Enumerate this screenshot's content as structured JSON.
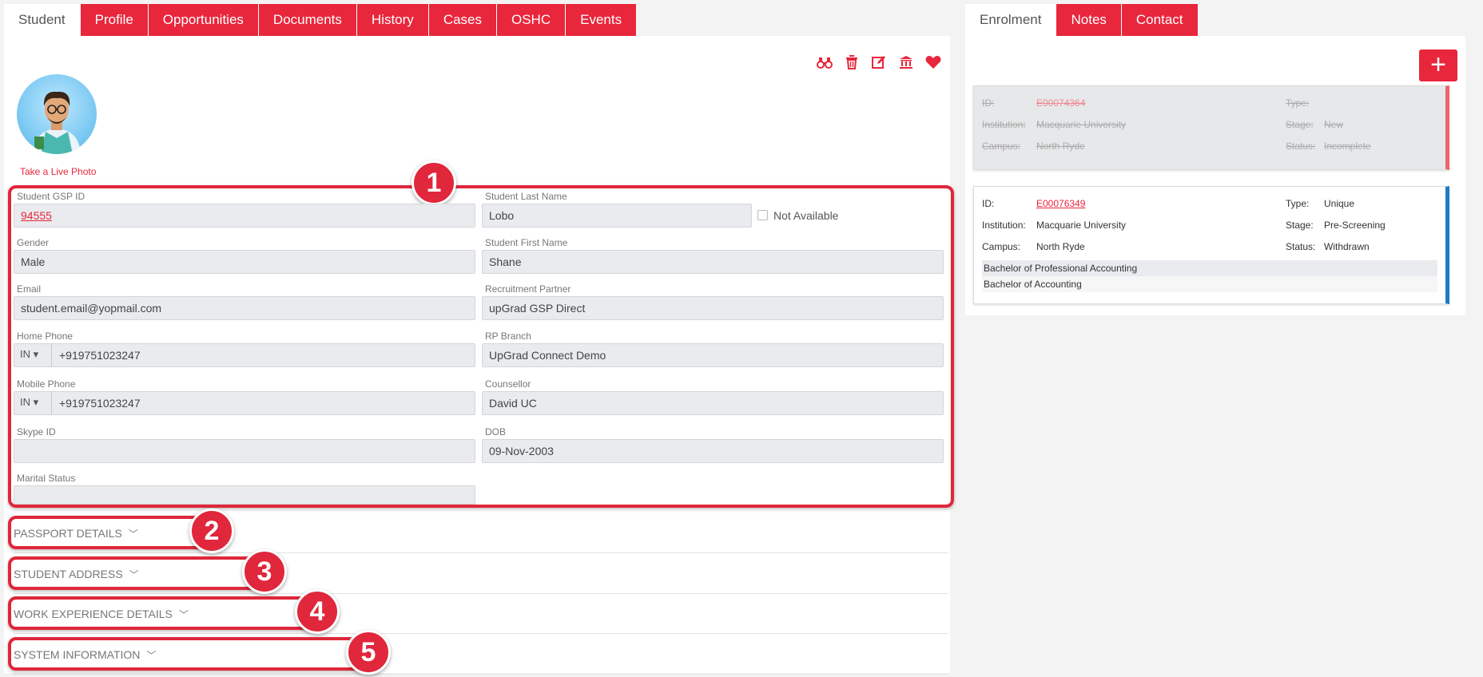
{
  "left_tabs": [
    "Student",
    "Profile",
    "Opportunities",
    "Documents",
    "History",
    "Cases",
    "OSHC",
    "Events"
  ],
  "right_tabs": [
    "Enrolment",
    "Notes",
    "Contact"
  ],
  "toolbar_icons": [
    "binoculars-icon",
    "trash-icon",
    "edit-icon",
    "institution-icon",
    "heart-icon"
  ],
  "live_photo_label": "Take a Live Photo",
  "fields": {
    "gsp_id": {
      "label": "Student GSP ID",
      "value": "94555"
    },
    "last_name": {
      "label": "Student Last Name",
      "value": "Lobo"
    },
    "not_available": "Not Available",
    "gender": {
      "label": "Gender",
      "value": "Male"
    },
    "first_name": {
      "label": "Student First Name",
      "value": "Shane"
    },
    "email": {
      "label": "Email",
      "value": "student.email@yopmail.com"
    },
    "partner": {
      "label": "Recruitment Partner",
      "value": "upGrad GSP Direct"
    },
    "home_phone": {
      "label": "Home Phone",
      "cc": "IN",
      "value": "+919751023247"
    },
    "rp_branch": {
      "label": "RP Branch",
      "value": "UpGrad Connect Demo"
    },
    "mobile_phone": {
      "label": "Mobile Phone",
      "cc": "IN",
      "value": "+919751023247"
    },
    "counsellor": {
      "label": "Counsellor",
      "value": "David UC"
    },
    "skype": {
      "label": "Skype ID",
      "value": ""
    },
    "dob": {
      "label": "DOB",
      "value": "09-Nov-2003"
    },
    "marital": {
      "label": "Marital Status",
      "value": ""
    }
  },
  "sections": [
    "PASSPORT DETAILS",
    "STUDENT ADDRESS",
    "WORK EXPERIENCE DETAILS",
    "SYSTEM INFORMATION"
  ],
  "badges": [
    "1",
    "2",
    "3",
    "4",
    "5"
  ],
  "add_button": "+",
  "enrolments": [
    {
      "id_label": "ID:",
      "id": "E00074364",
      "inst_label": "Institution:",
      "inst": "Macquarie University",
      "campus_label": "Campus:",
      "campus": "North Ryde",
      "type_label": "Type:",
      "type": "",
      "stage_label": "Stage:",
      "stage": "New",
      "status_label": "Status:",
      "status": "Incomplete"
    },
    {
      "id_label": "ID:",
      "id": "E00076349",
      "inst_label": "Institution:",
      "inst": "Macquarie University",
      "campus_label": "Campus:",
      "campus": "North Ryde",
      "type_label": "Type:",
      "type": "Unique",
      "stage_label": "Stage:",
      "stage": "Pre-Screening",
      "status_label": "Status:",
      "status": "Withdrawn",
      "courses": [
        "Bachelor of Professional Accounting",
        "Bachelor of Accounting"
      ]
    }
  ],
  "colors": {
    "accent": "#e8263c",
    "annotation": "#e0273b",
    "active_card": "#1f7ac6",
    "disabled_card": "#f06270"
  }
}
